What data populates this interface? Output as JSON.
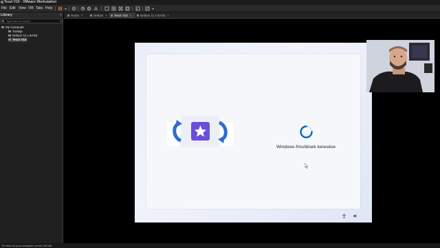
{
  "window": {
    "title": "Teszt V10 - VMware Workstation"
  },
  "menu": {
    "items": [
      "File",
      "Edit",
      "View",
      "VM",
      "Tabs",
      "Help"
    ]
  },
  "toolbar": {
    "icons": [
      "pause-icon",
      "power-dropdown-icon",
      "snapshot-icon",
      "revert-icon",
      "manage-snapshots-icon",
      "single-window-icon",
      "multi-window-icon",
      "fullscreen-icon",
      "unity-icon",
      "console-icon",
      "stretch-icon",
      "settings-icon"
    ]
  },
  "library": {
    "title": "Library",
    "search_placeholder": "Type here to search",
    "tree": [
      {
        "label": "My Computer",
        "level": 0
      },
      {
        "label": "Tuxteja",
        "level": 1
      },
      {
        "label": "Debian 11.x 64-bit",
        "level": 1
      },
      {
        "label": "Teszt V10",
        "level": 1,
        "selected": true
      }
    ]
  },
  "tabs": [
    {
      "label": "Home",
      "active": false
    },
    {
      "label": "Debian",
      "active": false
    },
    {
      "label": "Teszt V10",
      "active": true
    },
    {
      "label": "Debian 11 x 64-bit",
      "active": false
    }
  ],
  "guest": {
    "status_text": "Windows-frissítések keresése",
    "accent": "#0067c0",
    "icons": [
      "windows-update-illustration",
      "loading-spinner",
      "accessibility-icon",
      "volume-icon"
    ]
  },
  "statusbar": {
    "text": "To return to your computer, press Ctrl+Alt."
  },
  "colors": {
    "app_bg": "#1e1e1e",
    "guest_bg": "#eef1f9",
    "accent_purple": "#6b4fd8",
    "accent_blue": "#2f6bd3"
  }
}
